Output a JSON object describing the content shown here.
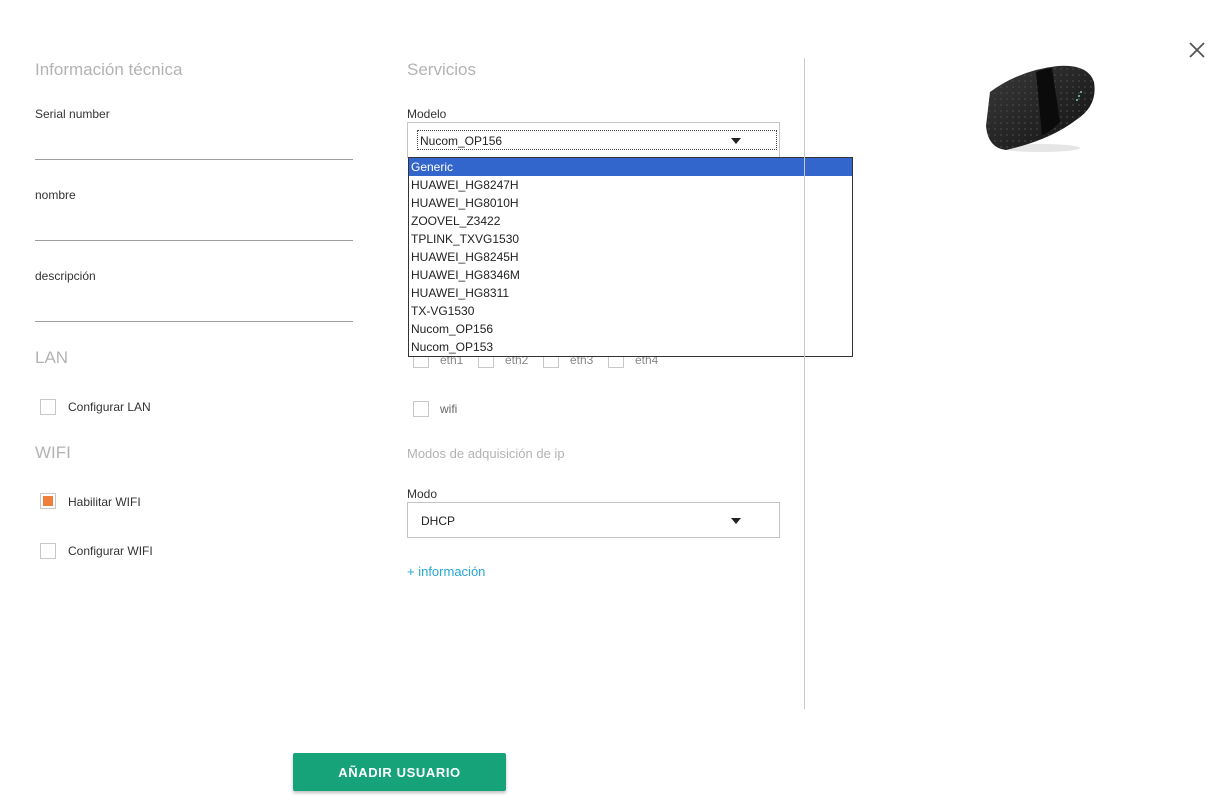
{
  "close_icon": "close-icon",
  "tech_info": {
    "title": "Información técnica",
    "fields": [
      {
        "label": "Serial number",
        "value": ""
      },
      {
        "label": "nombre",
        "value": ""
      },
      {
        "label": "descripción",
        "value": ""
      }
    ]
  },
  "lan": {
    "title": "LAN",
    "configure_label": "Configurar LAN",
    "configure_checked": false
  },
  "wifi": {
    "title": "WIFI",
    "enable_label": "Habilitar WIFI",
    "enable_checked": true,
    "configure_label": "Configurar WIFI",
    "configure_checked": false
  },
  "services": {
    "title": "Servicios",
    "model_label": "Modelo",
    "model_value": "Nucom_OP156",
    "model_options": [
      "Generic",
      "HUAWEI_HG8247H",
      "HUAWEI_HG8010H",
      "ZOOVEL_Z3422",
      "TPLINK_TXVG1530",
      "HUAWEI_HG8245H",
      "HUAWEI_HG8346M",
      "HUAWEI_HG8311",
      "TX-VG1530",
      "Nucom_OP156",
      "Nucom_OP153"
    ],
    "highlighted_option": "Generic",
    "eth_ports": [
      "eth1",
      "eth2",
      "eth3",
      "eth4"
    ],
    "wifi_label": "wifi"
  },
  "ip_modes": {
    "title": "Modos de adquisición de ip",
    "mode_label": "Modo",
    "mode_value": "DHCP",
    "more_info_link": "+ información"
  },
  "device_image": "router-image",
  "add_user_button": "AÑADIR USUARIO",
  "colors": {
    "accent_button": "#17a37a",
    "checkbox_checked": "#f07f3c",
    "link": "#27a7d6",
    "dropdown_highlight": "#3366cc"
  }
}
